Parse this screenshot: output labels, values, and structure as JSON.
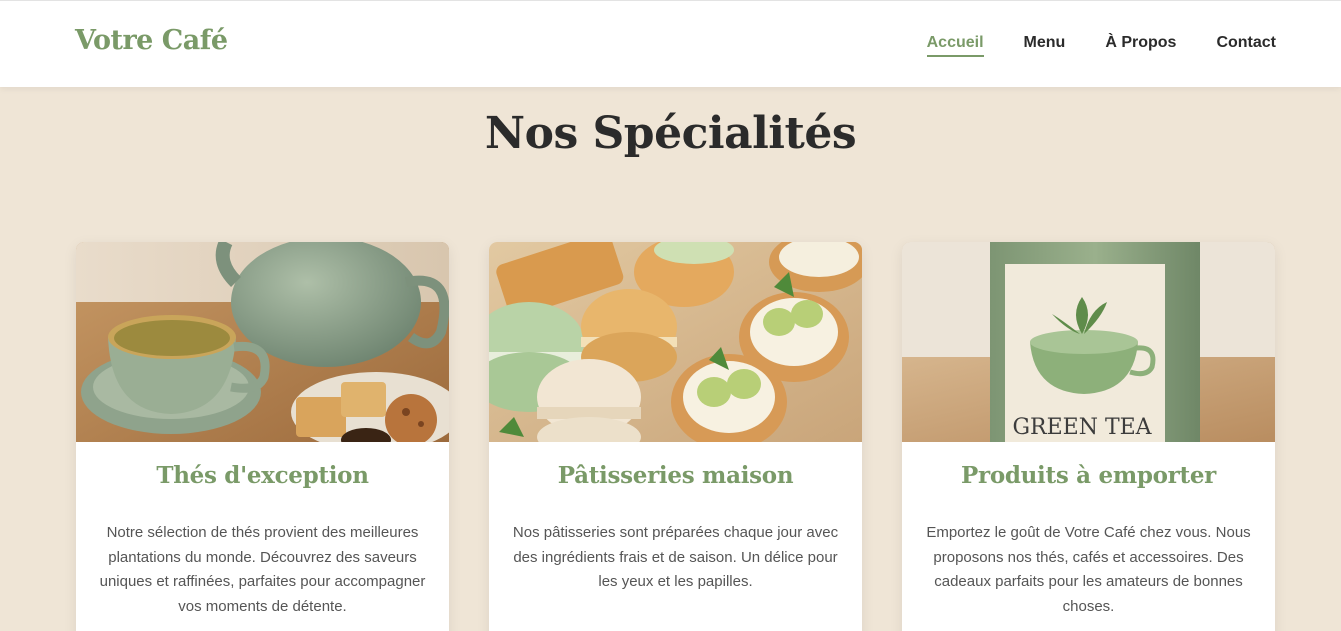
{
  "header": {
    "brand": "Votre Café",
    "nav": [
      {
        "label": "Accueil",
        "active": true
      },
      {
        "label": "Menu",
        "active": false
      },
      {
        "label": "À Propos",
        "active": false
      },
      {
        "label": "Contact",
        "active": false
      }
    ]
  },
  "section": {
    "title": "Nos Spécialités",
    "cards": [
      {
        "title": "Thés d'exception",
        "text": "Notre sélection de thés provient des meilleures plantations du monde. Découvrez des saveurs uniques et raffinées, parfaites pour accompagner vos moments de détente."
      },
      {
        "title": "Pâtisseries maison",
        "text": "Nos pâtisseries sont préparées chaque jour avec des ingrédients frais et de saison. Un délice pour les yeux et les papilles."
      },
      {
        "title": "Produits à emporter",
        "text": "Emportez le goût de Votre Café chez vous. Nous proposons nos thés, cafés et accessoires. Des cadeaux parfaits pour les amateurs de bonnes choses.",
        "image_text": "GREEN TEA"
      }
    ]
  },
  "colors": {
    "accent": "#7a9a68",
    "background": "#efe5d6",
    "text_dark": "#2b2b2b"
  }
}
